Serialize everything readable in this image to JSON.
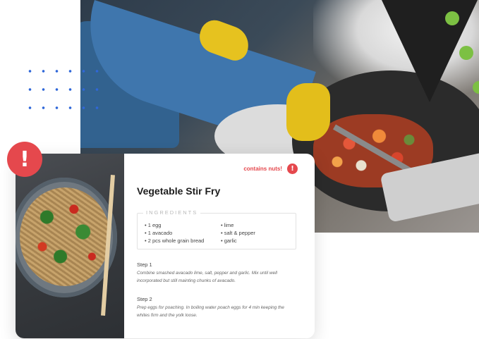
{
  "card": {
    "title": "Vegetable Stir Fry",
    "allergen_note": "contains nuts!",
    "alert_symbol": "!",
    "ingredients_heading": "INGREDIENTS",
    "ingredients_col1": [
      "• 1 egg",
      "• 1 avacado",
      "• 2 pcs whole grain bread"
    ],
    "ingredients_col2": [
      "• lime",
      "• salt & pepper",
      "• garlic"
    ],
    "steps": [
      {
        "label": "Step 1",
        "text": "Combine smashed avacado lime, salt, pepper and garlic. Mix until well incorporated but still mainting chunks of avacado."
      },
      {
        "label": "Step 2",
        "text": "Prep eggs for poaching. In boiling water poach eggs for 4 min keeping the whites firm and the yolk loose."
      }
    ]
  },
  "colors": {
    "alert": "#e5484d",
    "accent_green": "#7cc043",
    "dot_blue": "#2f67d8",
    "triangle": "#1f1f1f"
  }
}
